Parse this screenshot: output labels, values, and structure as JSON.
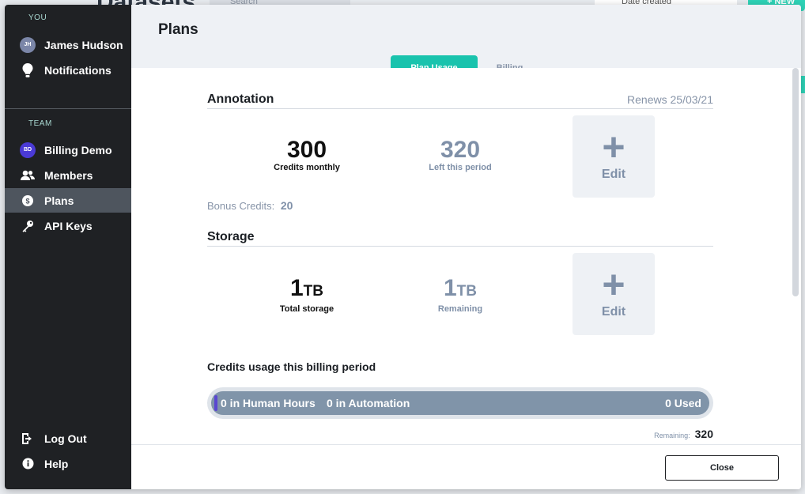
{
  "background": {
    "title": "Datasets",
    "search_placeholder": "Search",
    "sort_label": "Date created",
    "new_button": "+ NEW"
  },
  "sidebar": {
    "you_label": "YOU",
    "user": {
      "initials": "JH",
      "name": "James Hudson"
    },
    "notifications": "Notifications",
    "team_label": "TEAM",
    "team": {
      "initials": "BD",
      "name": "Billing Demo"
    },
    "members": "Members",
    "plans": "Plans",
    "api_keys": "API Keys",
    "logout": "Log Out",
    "help": "Help"
  },
  "header": {
    "title": "Plans",
    "tabs": [
      {
        "label": "Plan Usage",
        "active": true
      },
      {
        "label": "Billing",
        "active": false
      }
    ]
  },
  "annotation": {
    "title": "Annotation",
    "renews": "Renews 25/03/21",
    "credits_monthly_value": "300",
    "credits_monthly_label": "Credits monthly",
    "left_value": "320",
    "left_label": "Left this period",
    "edit_label": "Edit",
    "bonus_label": "Bonus Credits:",
    "bonus_value": "20"
  },
  "storage": {
    "title": "Storage",
    "total_value": "1",
    "total_unit": "TB",
    "total_label": "Total storage",
    "remaining_value": "1",
    "remaining_unit": "TB",
    "remaining_label": "Remaining",
    "edit_label": "Edit"
  },
  "usage": {
    "title": "Credits usage this billing period",
    "human_hours": "0 in Human Hours",
    "automation": "0 in Automation",
    "used": "0 Used",
    "remaining_label": "Remaining:",
    "remaining_value": "320"
  },
  "footer": {
    "close_label": "Close"
  },
  "colors": {
    "accent": "#19c3ad",
    "sidebar_bg": "#1f2124",
    "muted": "#7f90a8",
    "bar": "#8094a9"
  }
}
